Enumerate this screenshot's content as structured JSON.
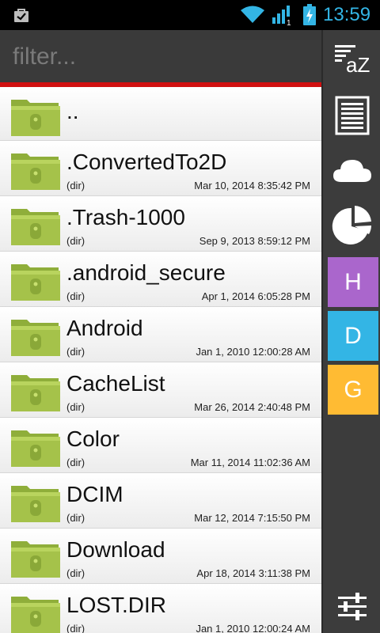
{
  "statusbar": {
    "time": "13:59",
    "signal_badge": "1",
    "colors": {
      "time": "#33b5e5",
      "icons": "#33b5e5"
    },
    "icons": [
      "shopping-bag-icon",
      "wifi-icon",
      "signal-icon",
      "battery-charging-icon"
    ]
  },
  "filter": {
    "placeholder": "filter..."
  },
  "files": [
    {
      "name": "..",
      "type": "",
      "date": ""
    },
    {
      "name": ".ConvertedTo2D",
      "type": "(dir)",
      "date": "Mar 10, 2014 8:35:42 PM"
    },
    {
      "name": ".Trash-1000",
      "type": "(dir)",
      "date": "Sep 9, 2013 8:59:12 PM"
    },
    {
      "name": ".android_secure",
      "type": "(dir)",
      "date": "Apr 1, 2014 6:05:28 PM"
    },
    {
      "name": "Android",
      "type": "(dir)",
      "date": "Jan 1, 2010 12:00:28 AM"
    },
    {
      "name": "CacheList",
      "type": "(dir)",
      "date": "Mar 26, 2014 2:40:48 PM"
    },
    {
      "name": "Color",
      "type": "(dir)",
      "date": "Mar 11, 2014 11:02:36 AM"
    },
    {
      "name": "DCIM",
      "type": "(dir)",
      "date": "Mar 12, 2014 7:15:50 PM"
    },
    {
      "name": "Download",
      "type": "(dir)",
      "date": "Apr 18, 2014 3:11:38 PM"
    },
    {
      "name": "LOST.DIR",
      "type": "(dir)",
      "date": "Jan 1, 2010 12:00:24 AM"
    }
  ],
  "sidebar": {
    "sort_label": "aZ",
    "tiles": [
      {
        "label": "H",
        "color": "#aa66cc"
      },
      {
        "label": "D",
        "color": "#33b5e5"
      },
      {
        "label": "G",
        "color": "#ffbb33"
      }
    ],
    "icons": [
      "sort-az-icon",
      "list-view-icon",
      "cloud-icon",
      "pie-chart-icon",
      "settings-sliders-icon"
    ]
  },
  "colors": {
    "accent_bar": "#d01010",
    "folder": "#a5c24a",
    "header": "#3a3a3a",
    "sidebar": "#3c3c3c"
  }
}
